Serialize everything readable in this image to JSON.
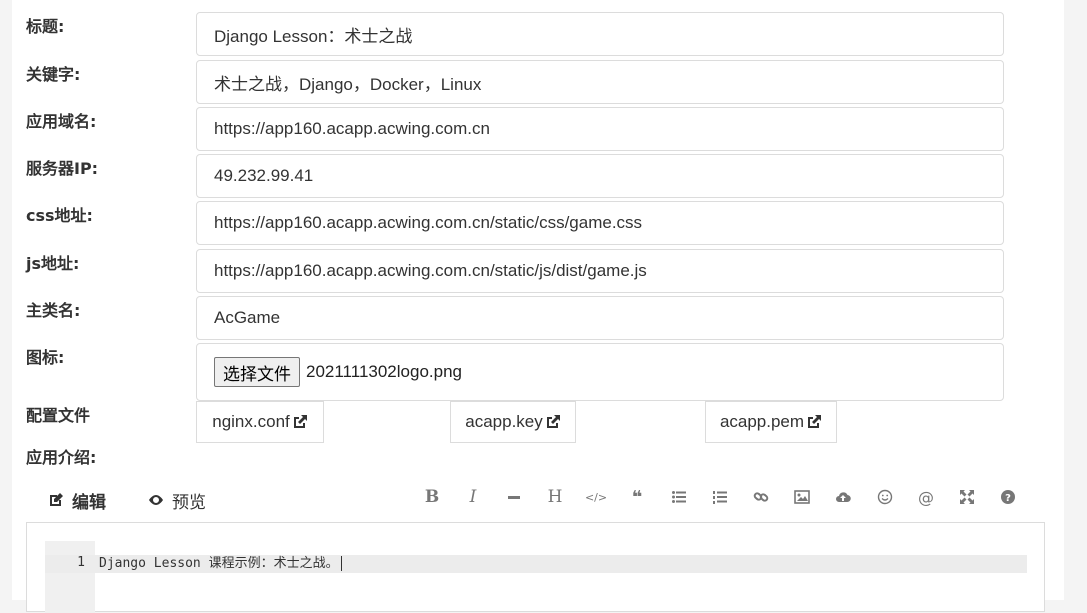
{
  "form": {
    "title_label": "标题:",
    "title_value": "Django Lesson：术士之战",
    "keywords_label": "关键字:",
    "keywords_value": "术士之战，Django，Docker，Linux",
    "domain_label": "应用域名:",
    "domain_value": "https://app160.acapp.acwing.com.cn",
    "server_ip_label": "服务器IP:",
    "server_ip_value": "49.232.99.41",
    "css_label": "css地址:",
    "css_value": "https://app160.acapp.acwing.com.cn/static/css/game.css",
    "js_label": "js地址:",
    "js_value": "https://app160.acapp.acwing.com.cn/static/js/dist/game.js",
    "main_class_label": "主类名:",
    "main_class_value": "AcGame",
    "icon_label": "图标:",
    "choose_file_label": "选择文件",
    "chosen_file_name": "2021111302logo.png",
    "config_label": "配置文件",
    "config_files": [
      "nginx.conf",
      "acapp.key",
      "acapp.pem"
    ],
    "intro_label": "应用介绍:"
  },
  "editor": {
    "tabs": [
      "编辑",
      "预览"
    ],
    "active_tab": "编辑",
    "toolbar_icons": [
      "bold-icon",
      "italic-icon",
      "horizontal-rule-icon",
      "heading-icon",
      "code-icon",
      "quote-icon",
      "unordered-list-icon",
      "ordered-list-icon",
      "link-icon",
      "image-icon",
      "upload-icon",
      "emoji-icon",
      "mention-icon",
      "fullscreen-icon",
      "help-icon"
    ],
    "toolbar_glyphs": {
      "bold": "B",
      "italic": "I",
      "heading": "H",
      "code": "</>",
      "quote": "❝",
      "mention": "@"
    },
    "line_number": "1",
    "line_text": "Django Lesson 课程示例：术士之战。"
  }
}
